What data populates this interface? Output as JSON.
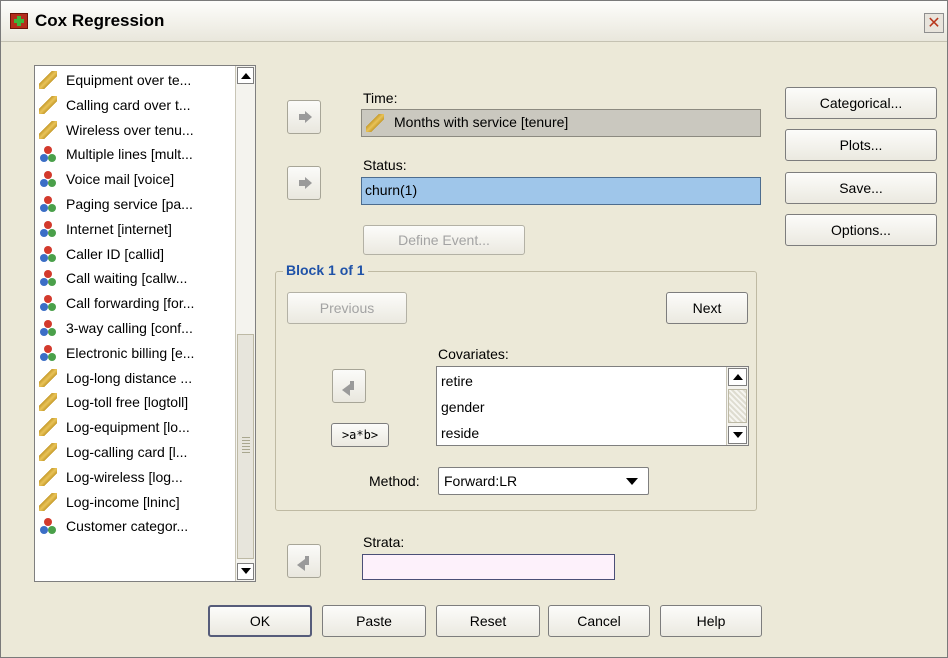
{
  "window": {
    "title": "Cox Regression",
    "close_glyph": "✕",
    "icon": "app-icon"
  },
  "variables": [
    {
      "label": "Equipment over te...",
      "icon": "scale-ruler-icon"
    },
    {
      "label": "Calling card over t...",
      "icon": "scale-ruler-icon"
    },
    {
      "label": "Wireless over tenu...",
      "icon": "scale-ruler-icon"
    },
    {
      "label": "Multiple lines [mult...",
      "icon": "nominal-icon"
    },
    {
      "label": "Voice mail [voice]",
      "icon": "nominal-icon"
    },
    {
      "label": "Paging service [pa...",
      "icon": "nominal-icon"
    },
    {
      "label": "Internet [internet]",
      "icon": "nominal-icon"
    },
    {
      "label": "Caller ID [callid]",
      "icon": "nominal-icon"
    },
    {
      "label": "Call waiting [callw...",
      "icon": "nominal-icon"
    },
    {
      "label": "Call forwarding [for...",
      "icon": "nominal-icon"
    },
    {
      "label": "3-way calling [conf...",
      "icon": "nominal-icon"
    },
    {
      "label": "Electronic billing [e...",
      "icon": "nominal-icon"
    },
    {
      "label": "Log-long distance ...",
      "icon": "scale-ruler-icon"
    },
    {
      "label": "Log-toll free [logtoll]",
      "icon": "scale-ruler-icon"
    },
    {
      "label": "Log-equipment [lo...",
      "icon": "scale-ruler-icon"
    },
    {
      "label": "Log-calling card [l...",
      "icon": "scale-ruler-icon"
    },
    {
      "label": "Log-wireless [log...",
      "icon": "scale-ruler-icon"
    },
    {
      "label": "Log-income [lninc]",
      "icon": "scale-ruler-icon"
    },
    {
      "label": "Customer categor...",
      "icon": "nominal-icon"
    }
  ],
  "time": {
    "label": "Time:",
    "value": "Months with service [tenure]",
    "icon": "scale-ruler-icon"
  },
  "status": {
    "label": "Status:",
    "value": "churn(1)"
  },
  "define_event": "Define Event...",
  "block": {
    "title": "Block 1 of 1",
    "previous": "Previous",
    "next": "Next",
    "covariates_label": "Covariates:",
    "covariates": [
      "retire",
      "gender",
      "reside"
    ],
    "interaction": ">a*b>",
    "method_label": "Method:",
    "method_value": "Forward:LR"
  },
  "strata": {
    "label": "Strata:",
    "value": ""
  },
  "side_buttons": {
    "categorical": "Categorical...",
    "plots": "Plots...",
    "save": "Save...",
    "options": "Options..."
  },
  "bottom_buttons": {
    "ok": "OK",
    "paste": "Paste",
    "reset": "Reset",
    "cancel": "Cancel",
    "help": "Help"
  },
  "colors": {
    "dialog_bg": "#ece9d8",
    "selected_field": "#9fc6ea",
    "block_title": "#1f52a8",
    "strata_field": "#fdf1fb",
    "time_field": "#cac8bf"
  }
}
